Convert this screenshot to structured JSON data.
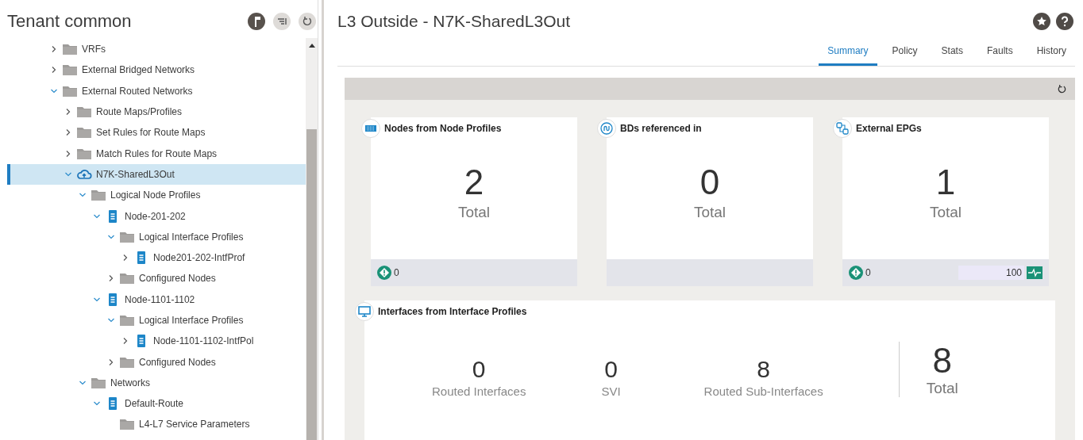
{
  "sidebar": {
    "title": "Tenant common",
    "tree": [
      {
        "label": "VRFs",
        "kind": "folder",
        "expanded": false,
        "selected": false
      },
      {
        "label": "External Bridged Networks",
        "kind": "folder",
        "expanded": false,
        "selected": false
      },
      {
        "label": "External Routed Networks",
        "kind": "folder",
        "expanded": true,
        "selected": false,
        "children": [
          {
            "label": "Route Maps/Profiles",
            "kind": "folder",
            "expanded": false,
            "selected": false
          },
          {
            "label": "Set Rules for Route Maps",
            "kind": "folder",
            "expanded": false,
            "selected": false
          },
          {
            "label": "Match Rules for Route Maps",
            "kind": "folder",
            "expanded": false,
            "selected": false
          },
          {
            "label": "N7K-SharedL3Out",
            "kind": "cloud",
            "expanded": true,
            "selected": true,
            "children": [
              {
                "label": "Logical Node Profiles",
                "kind": "folder",
                "expanded": true,
                "selected": false,
                "children": [
                  {
                    "label": "Node-201-202",
                    "kind": "doc",
                    "expanded": true,
                    "selected": false,
                    "children": [
                      {
                        "label": "Logical Interface Profiles",
                        "kind": "folder",
                        "expanded": true,
                        "selected": false,
                        "children": [
                          {
                            "label": "Node201-202-IntfProf",
                            "kind": "doc",
                            "expanded": false,
                            "selected": false
                          }
                        ]
                      },
                      {
                        "label": "Configured Nodes",
                        "kind": "folder",
                        "expanded": false,
                        "selected": false
                      }
                    ]
                  },
                  {
                    "label": "Node-1101-1102",
                    "kind": "doc",
                    "expanded": true,
                    "selected": false,
                    "children": [
                      {
                        "label": "Logical Interface Profiles",
                        "kind": "folder",
                        "expanded": true,
                        "selected": false,
                        "children": [
                          {
                            "label": "Node-1101-1102-IntfPol",
                            "kind": "doc",
                            "expanded": false,
                            "selected": false
                          }
                        ]
                      },
                      {
                        "label": "Configured Nodes",
                        "kind": "folder",
                        "expanded": false,
                        "selected": false
                      }
                    ]
                  }
                ]
              },
              {
                "label": "Networks",
                "kind": "folder",
                "expanded": true,
                "selected": false,
                "children": [
                  {
                    "label": "Default-Route",
                    "kind": "doc",
                    "expanded": true,
                    "selected": false,
                    "children": [
                      {
                        "label": "L4-L7 Service Parameters",
                        "kind": "folder",
                        "selected": false
                      }
                    ]
                  }
                ]
              }
            ]
          }
        ]
      }
    ]
  },
  "main": {
    "title": "L3 Outside - N7K-SharedL3Out",
    "tabs": [
      {
        "label": "Summary",
        "selected": true
      },
      {
        "label": "Policy",
        "selected": false
      },
      {
        "label": "Stats",
        "selected": false
      },
      {
        "label": "Faults",
        "selected": false
      },
      {
        "label": "History",
        "selected": false
      }
    ],
    "cards": [
      {
        "title": "Nodes from Node Profiles",
        "kind": "nodes",
        "value": "2",
        "caption": "Total",
        "faults": "0"
      },
      {
        "title": "BDs referenced in",
        "kind": "bds",
        "value": "0",
        "caption": "Total"
      },
      {
        "title": "External EPGs",
        "kind": "epgs",
        "value": "1",
        "caption": "Total",
        "faults": "0",
        "health": "100"
      }
    ],
    "interfaces": {
      "title": "Interfaces from Interface Profiles",
      "stats": [
        {
          "value": "0",
          "label": "Routed Interfaces"
        },
        {
          "value": "0",
          "label": "SVI"
        },
        {
          "value": "8",
          "label": "Routed Sub-Interfaces"
        }
      ],
      "total": {
        "value": "8",
        "label": "Total"
      }
    }
  }
}
